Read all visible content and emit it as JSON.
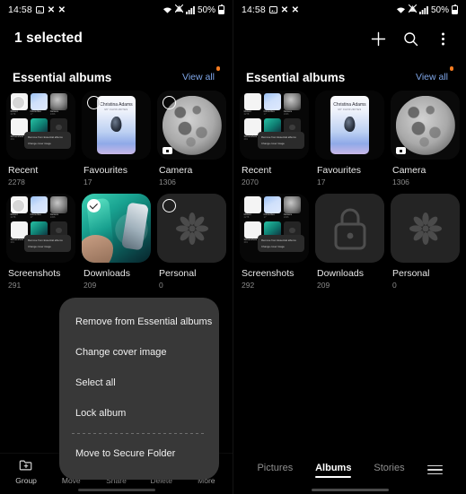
{
  "status_bar": {
    "time": "14:58",
    "icons": [
      "picture-icon",
      "x-icon",
      "x-icon"
    ],
    "wifi": "wifi-icon",
    "network": "network-icon",
    "signal": "signal-icon",
    "battery_percent": "50%"
  },
  "left_phone": {
    "app_bar": {
      "title": "1 selected"
    },
    "section": {
      "title": "Essential albums",
      "view_all": "View all"
    },
    "albums": [
      {
        "name": "Recent",
        "count": "2278",
        "art": "recent",
        "selected": false,
        "selection": true,
        "video_badge": false
      },
      {
        "name": "Favourites",
        "count": "17",
        "art": "fav",
        "selected": false,
        "selection": true,
        "video_badge": false
      },
      {
        "name": "Camera",
        "count": "1306",
        "art": "camera",
        "selected": false,
        "selection": true,
        "video_badge": true
      },
      {
        "name": "Screenshots",
        "count": "291",
        "art": "shots",
        "selected": false,
        "selection": true,
        "video_badge": false
      },
      {
        "name": "Downloads",
        "count": "209",
        "art": "dl",
        "selected": true,
        "selection": true,
        "video_badge": false
      },
      {
        "name": "Personal",
        "count": "0",
        "art": "personal",
        "selected": false,
        "selection": true,
        "video_badge": false
      }
    ],
    "context_menu": {
      "items": [
        {
          "label": "Remove from Essential albums"
        },
        {
          "label": "Change cover image"
        },
        {
          "label": "Select all"
        },
        {
          "label": "Lock album"
        }
      ],
      "divided_items": [
        {
          "label": "Move to Secure Folder"
        }
      ]
    },
    "bottom_bar": [
      {
        "label": "Group",
        "icon": "folder-plus-icon"
      },
      {
        "label": "Move",
        "icon": "folder-arrow-icon"
      },
      {
        "label": "Share",
        "icon": "share-icon"
      },
      {
        "label": "Delete",
        "icon": "trash-icon"
      },
      {
        "label": "More",
        "icon": "more-vertical-icon"
      }
    ]
  },
  "right_phone": {
    "app_bar": {
      "title": "",
      "actions": [
        {
          "name": "add-icon"
        },
        {
          "name": "search-icon"
        },
        {
          "name": "more-vertical-icon"
        }
      ]
    },
    "section": {
      "title": "Essential albums",
      "view_all": "View all"
    },
    "albums": [
      {
        "name": "Recent",
        "count": "2070",
        "art": "recent",
        "selected": false,
        "selection": false,
        "video_badge": false
      },
      {
        "name": "Favourites",
        "count": "17",
        "art": "fav",
        "selected": false,
        "selection": false,
        "video_badge": false
      },
      {
        "name": "Camera",
        "count": "1306",
        "art": "camera",
        "selected": false,
        "selection": false,
        "video_badge": true
      },
      {
        "name": "Screenshots",
        "count": "292",
        "art": "shots",
        "selected": false,
        "selection": false,
        "video_badge": false
      },
      {
        "name": "Downloads",
        "count": "209",
        "art": "locked",
        "selected": false,
        "selection": false,
        "video_badge": false
      },
      {
        "name": "Personal",
        "count": "0",
        "art": "personal",
        "selected": false,
        "selection": false,
        "video_badge": false
      }
    ],
    "bottom_nav": {
      "tabs": [
        {
          "label": "Pictures",
          "active": false
        },
        {
          "label": "Albums",
          "active": true
        },
        {
          "label": "Stories",
          "active": false
        }
      ],
      "menu_icon": "hamburger-icon"
    }
  },
  "mini_thumb_labels": [
    {
      "title": "Recent",
      "count": "2278"
    },
    {
      "title": "Favourites",
      "count": "17"
    },
    {
      "title": "Camera",
      "count": "1306"
    },
    {
      "title": "Screenshots",
      "count": "291"
    },
    {
      "title": "Downloads",
      "count": "209"
    },
    {
      "title": "Personal",
      "count": "0"
    }
  ],
  "nested_menu_items": [
    "Remove from Essential albums",
    "Change cover image"
  ],
  "favourites_card": {
    "name": "Christina Adams",
    "subtitle": "MY FAVOURITES"
  },
  "colors": {
    "background": "#000000",
    "menu_bg": "#383838",
    "link": "#7fa6e8",
    "badge": "#f57c20",
    "text_primary": "#ffffff",
    "text_secondary": "#8a8a8a"
  }
}
